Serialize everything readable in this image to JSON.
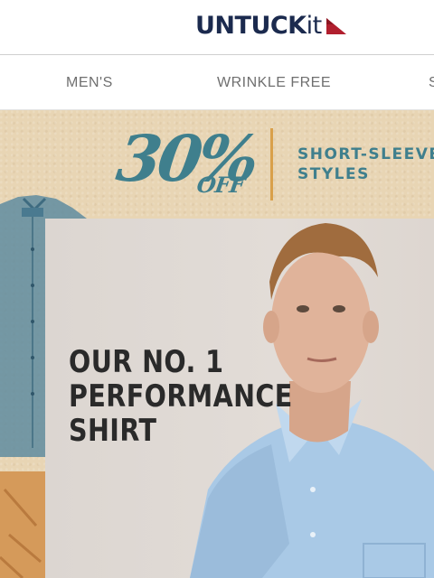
{
  "header": {
    "logo": {
      "text_main": "UNTUCK",
      "text_suffix": "it",
      "brand_color": "#1b2a4e",
      "accent_color": "#b11f2e"
    }
  },
  "nav": {
    "items": [
      {
        "label": "MEN'S"
      },
      {
        "label": "WRINKLE FREE"
      },
      {
        "label": "S"
      }
    ]
  },
  "promo": {
    "percent": "30%",
    "off": "OFF",
    "line1": "SHORT-SLEEVE",
    "line2": "STYLES",
    "accent_color": "#3f7f8d",
    "divider_color": "#d9a04a"
  },
  "hero": {
    "headline": [
      "OUR NO. 1",
      "PERFORMANCE",
      "SHIRT"
    ],
    "background_color": "#e8d5b4"
  }
}
